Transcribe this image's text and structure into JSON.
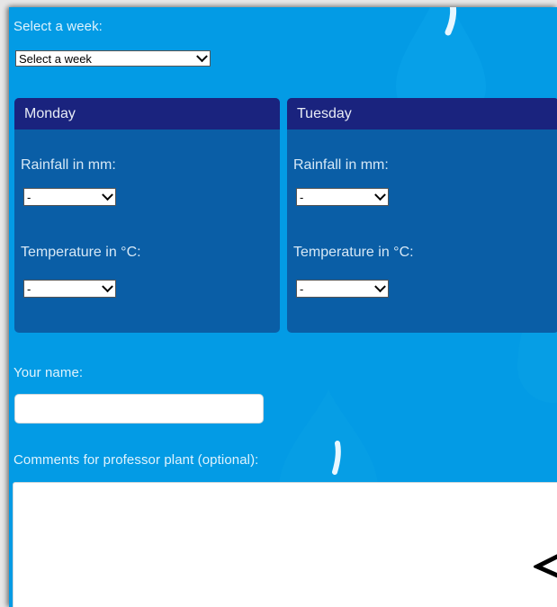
{
  "form": {
    "week_label": "Select a week:",
    "week_select_value": "Select a week",
    "days": [
      {
        "name": "Monday",
        "rainfall_label": "Rainfall in mm:",
        "rainfall_value": "-",
        "temperature_label": "Temperature in °C:",
        "temperature_value": "-"
      },
      {
        "name": "Tuesday",
        "rainfall_label": "Rainfall in mm:",
        "rainfall_value": "-",
        "temperature_label": "Temperature in °C:",
        "temperature_value": "-"
      }
    ],
    "name_label": "Your name:",
    "name_value": "",
    "comments_label": "Comments for professor plant (optional):",
    "comments_value": ""
  },
  "icons": {
    "raindrop": "raindrop-icon",
    "chevron": "chevron-down-icon",
    "cursor_glyph": "less-than-icon"
  },
  "colors": {
    "background": "#039be5",
    "card": "#0a5ea6",
    "card_header": "#1a237e",
    "label_text": "#dff3fd"
  }
}
